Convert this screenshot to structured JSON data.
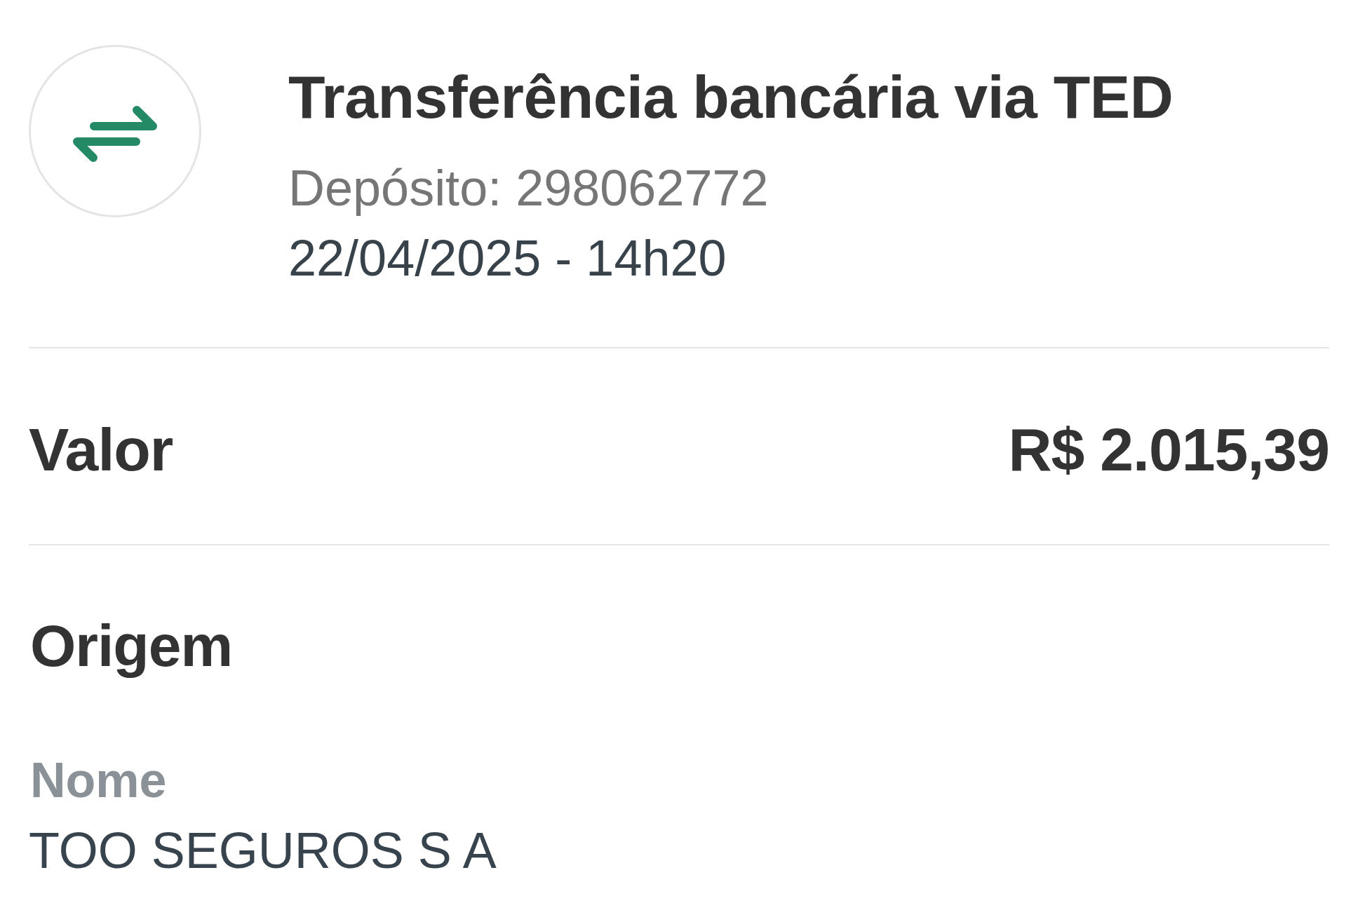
{
  "header": {
    "title": "Transferência bancária via TED",
    "subtitle": "Depósito: 298062772",
    "datetime": "22/04/2025 - 14h20"
  },
  "amount": {
    "label": "Valor",
    "value": "R$ 2.015,39"
  },
  "origin": {
    "heading": "Origem",
    "fields": [
      {
        "label": "Nome",
        "value": "TOO SEGUROS S A"
      }
    ]
  }
}
